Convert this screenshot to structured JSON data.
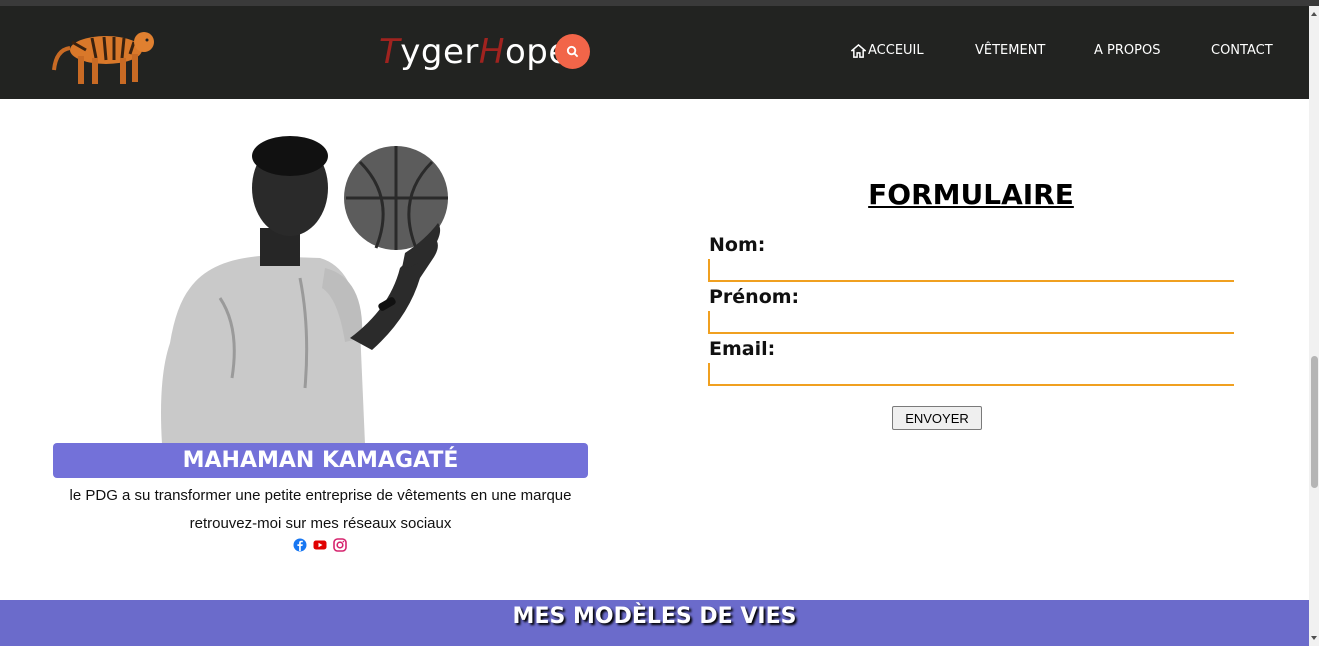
{
  "header": {
    "brand_t": "T",
    "brand_yger": "yger",
    "brand_h": "H",
    "brand_ope": "ope",
    "nav": {
      "home": "ACCEUIL",
      "clothing": "VÊTEMENT",
      "about": "A PROPOS",
      "contact": "CONTACT"
    }
  },
  "profile": {
    "name": "MAHAMAN KAMAGATÉ",
    "bio_line1": "le PDG a su transformer une petite entreprise de vêtements en une marque",
    "bio_line2": "retrouvez-moi sur mes réseaux sociaux",
    "socials": [
      "facebook-icon",
      "youtube-icon",
      "instagram-icon"
    ]
  },
  "form": {
    "title": "FORMULAIRE",
    "name_label": "Nom:",
    "firstname_label": "Prénom:",
    "email_label": "Email:",
    "name_value": "",
    "firstname_value": "",
    "email_value": "",
    "submit_label": "ENVOYER"
  },
  "banner": {
    "title": "MES MODÈLES DE VIES"
  },
  "colors": {
    "header_bg": "#222321",
    "accent_search": "#f26549",
    "brand_accent": "#a0231f",
    "name_bar": "#7371d9",
    "input_border": "#f0a020",
    "banner_bg": "#6b6bcb"
  }
}
